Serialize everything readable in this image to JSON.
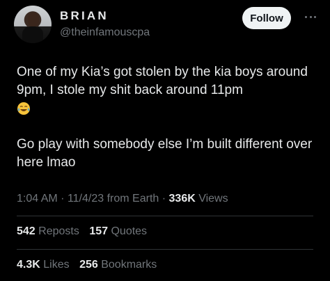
{
  "user": {
    "name": "BRIAN",
    "handle": "@theinfamouscpa"
  },
  "follow_label": "Follow",
  "tweet": {
    "line1": "One of my Kia’s got stolen by the kia boys around 9pm, I stole my shit back around 11pm",
    "line2": "Go play with somebody else I’m built different over here lmao"
  },
  "meta": {
    "time": "1:04 AM",
    "date": "11/4/23",
    "source": "from Earth",
    "views_count": "336K",
    "views_label": "Views",
    "sep": "·"
  },
  "stats": {
    "reposts_count": "542",
    "reposts_label": "Reposts",
    "quotes_count": "157",
    "quotes_label": "Quotes",
    "likes_count": "4.3K",
    "likes_label": "Likes",
    "bookmarks_count": "256",
    "bookmarks_label": "Bookmarks"
  },
  "icons": {
    "emoji": "face-with-tears-of-joy",
    "more": "more-dots-icon"
  },
  "colors": {
    "background": "#000000",
    "text": "#e7e9ea",
    "muted": "#71767b",
    "follow_bg": "#eff3f4"
  }
}
